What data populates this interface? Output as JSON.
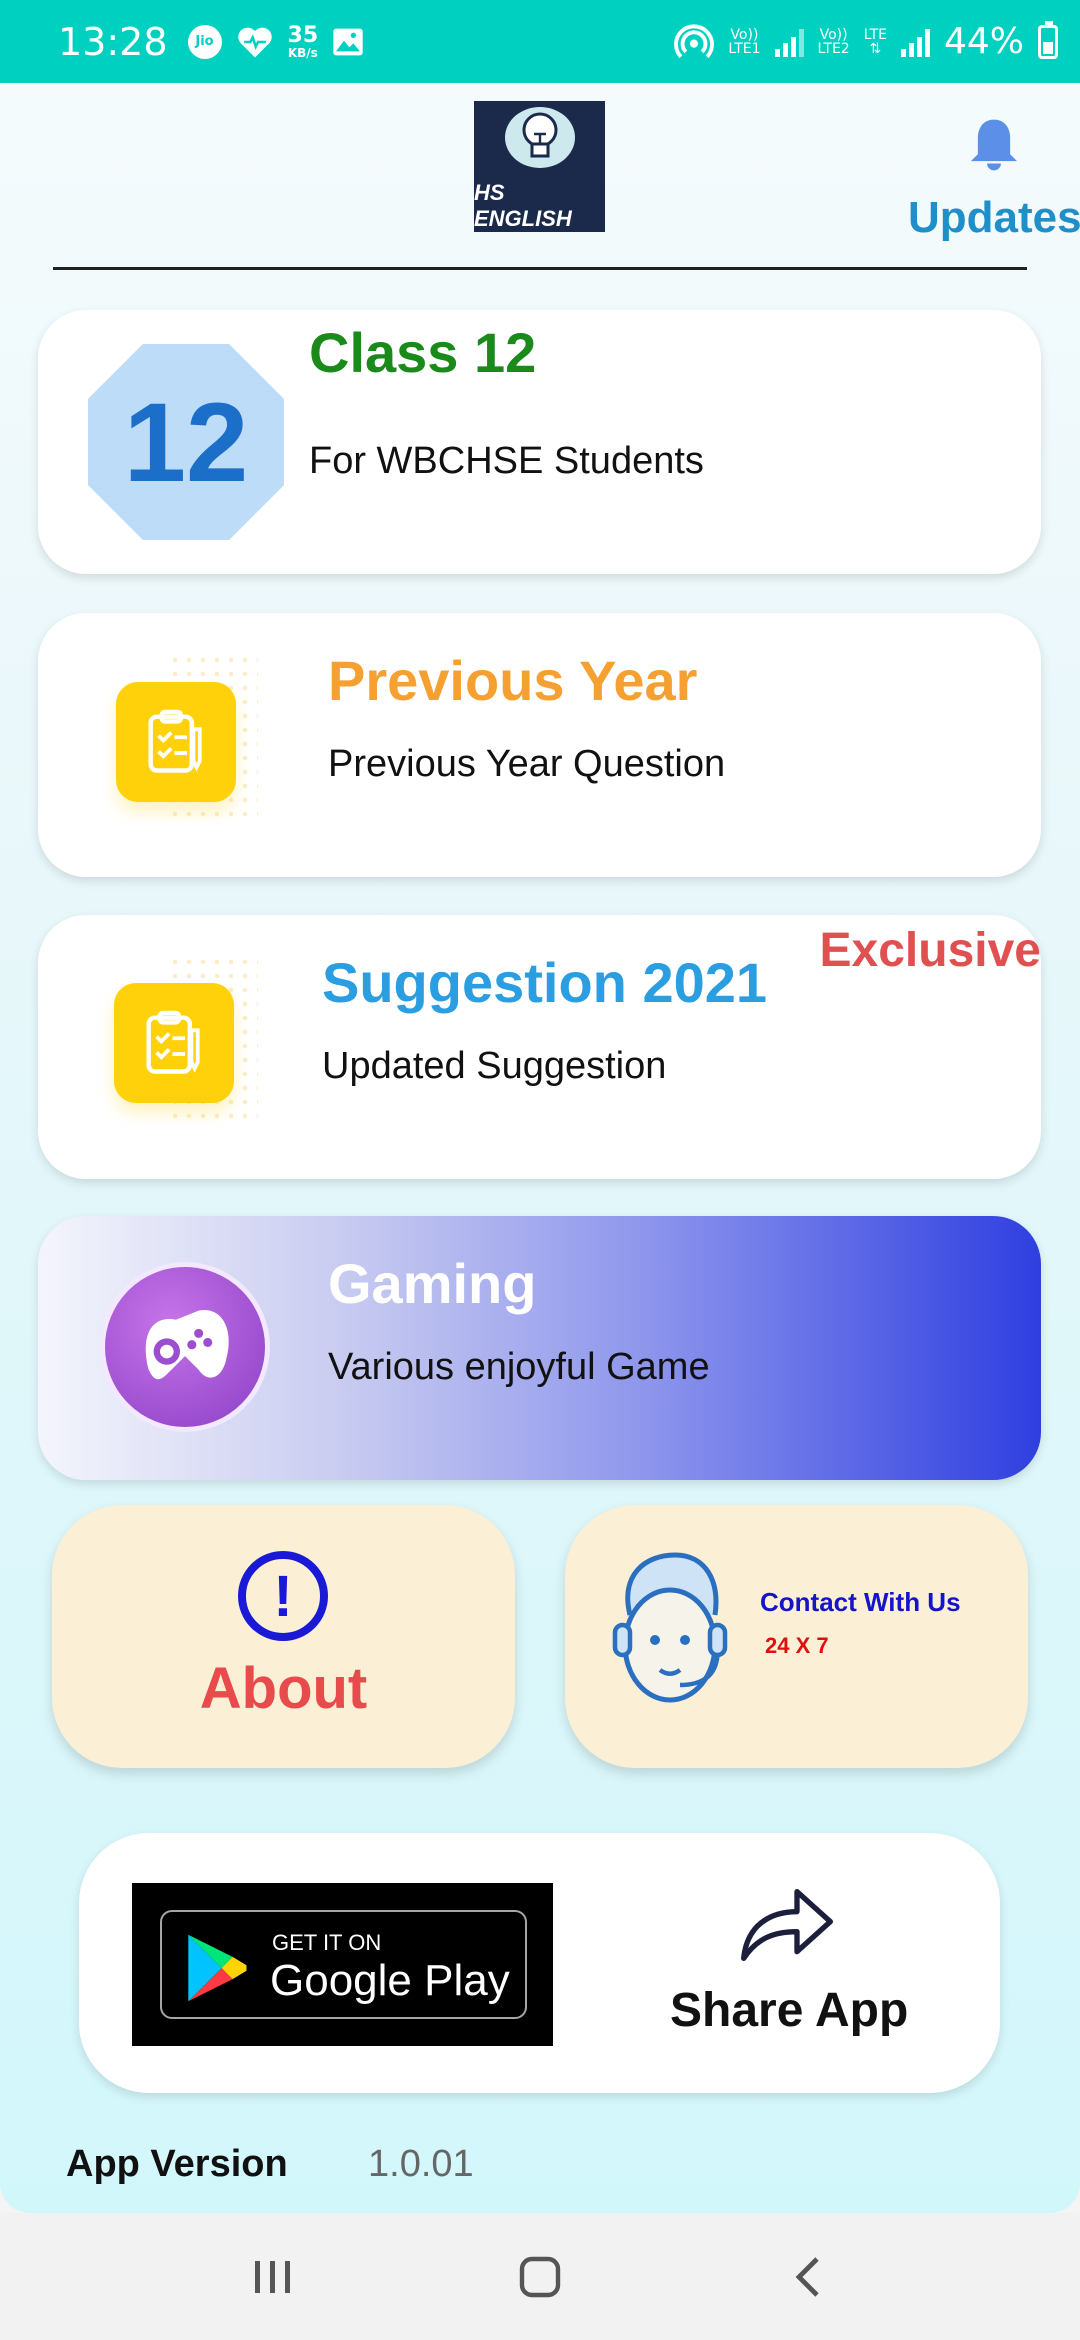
{
  "status_bar": {
    "time": "13:28",
    "net_speed_value": "35",
    "net_speed_unit": "KB/s",
    "sim1": "Vo))\nLTE1",
    "sim1_top": "Vo))",
    "sim1_bottom": "LTE1",
    "sim2_top": "Vo))",
    "sim2_bottom": "LTE2",
    "lte_label": "LTE",
    "battery": "44%",
    "jio": "Jio"
  },
  "header": {
    "logo_text": "HS ENGLISH",
    "updates_label": "Updates"
  },
  "cards": {
    "class12": {
      "badge": "12",
      "title": "Class 12",
      "subtitle": "For WBCHSE Students"
    },
    "previous_year": {
      "title": "Previous Year",
      "subtitle": "Previous Year Question"
    },
    "suggestion": {
      "title": "Suggestion 2021",
      "subtitle": "Updated Suggestion",
      "badge": "Exclusive"
    },
    "gaming": {
      "title": "Gaming",
      "subtitle": "Various enjoyful Game"
    },
    "about": {
      "title": "About"
    },
    "contact": {
      "title": "Contact With Us",
      "subtitle": "24 X 7"
    }
  },
  "bottom": {
    "play_get": "GET IT ON",
    "play_store": "Google Play",
    "share_label": "Share App"
  },
  "version": {
    "label": "App Version",
    "value": "1.0.01"
  },
  "colors": {
    "status_bar": "#00d0c0",
    "class_title": "#1a8a1a",
    "previous_title": "#f5a030",
    "suggestion_title": "#2a9ee0",
    "exclusive": "#e05050",
    "about": "#e84b4b"
  },
  "icons": [
    "jio-icon",
    "heart-icon",
    "image-icon",
    "hotspot-icon",
    "signal-icon",
    "battery-icon",
    "bell-icon",
    "clipboard-icon",
    "gamepad-icon",
    "alert-icon",
    "support-agent-icon",
    "play-store-icon",
    "share-icon",
    "recents-icon",
    "home-icon",
    "back-icon"
  ]
}
